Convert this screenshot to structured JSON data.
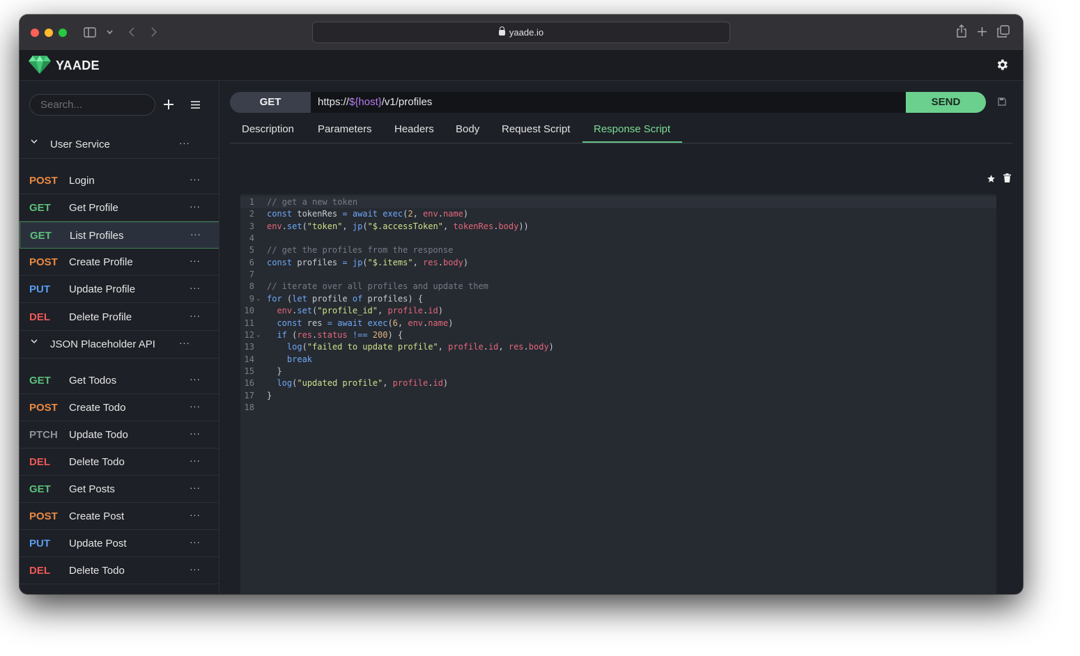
{
  "browser": {
    "url": "yaade.io"
  },
  "app": {
    "brand": "YAADE",
    "colors": {
      "accent": "#6bcf8e",
      "background": "#1d2026",
      "post": "#ea8a43",
      "get": "#5cbf7c",
      "put": "#5b9cee",
      "del": "#ee5959",
      "ptch": "#8d929b"
    }
  },
  "sidebar": {
    "search_placeholder": "Search...",
    "groups": [
      {
        "name": "User Service",
        "items": [
          {
            "method": "POST",
            "name": "Login"
          },
          {
            "method": "GET",
            "name": "Get Profile"
          },
          {
            "method": "GET",
            "name": "List Profiles"
          },
          {
            "method": "POST",
            "name": "Create Profile"
          },
          {
            "method": "PUT",
            "name": "Update Profile"
          },
          {
            "method": "DEL",
            "name": "Delete Profile"
          }
        ]
      },
      {
        "name": "JSON Placeholder API",
        "items": [
          {
            "method": "GET",
            "name": "Get Todos"
          },
          {
            "method": "POST",
            "name": "Create Todo"
          },
          {
            "method": "PTCH",
            "name": "Update Todo"
          },
          {
            "method": "DEL",
            "name": "Delete Todo"
          },
          {
            "method": "GET",
            "name": "Get Posts"
          },
          {
            "method": "POST",
            "name": "Create Post"
          },
          {
            "method": "PUT",
            "name": "Update Post"
          },
          {
            "method": "DEL",
            "name": "Delete Todo"
          }
        ]
      }
    ],
    "selected": "List Profiles",
    "dots": "···"
  },
  "request": {
    "method": "GET",
    "url_prefix": "https://",
    "url_var": "${host}",
    "url_suffix": "/v1/profiles",
    "send_label": "SEND"
  },
  "tabs": [
    "Description",
    "Parameters",
    "Headers",
    "Body",
    "Request Script",
    "Response Script"
  ],
  "active_tab": "Response Script",
  "editor": {
    "lines": [
      "// get a new token",
      "const tokenRes = await exec(2, env.name)",
      "env.set(\"token\", jp(\"$.accessToken\", tokenRes.body))",
      "",
      "// get the profiles from the response",
      "const profiles = jp(\"$.items\", res.body)",
      "",
      "// iterate over all profiles and update them",
      "for (let profile of profiles) {",
      "  env.set(\"profile_id\", profile.id)",
      "  const res = await exec(6, env.name)",
      "  if (res.status !== 200) {",
      "    log(\"failed to update profile\", profile.id, res.body)",
      "    break",
      "  }",
      "  log(\"updated profile\", profile.id)",
      "}",
      ""
    ],
    "fold_lines": [
      9,
      12
    ]
  }
}
